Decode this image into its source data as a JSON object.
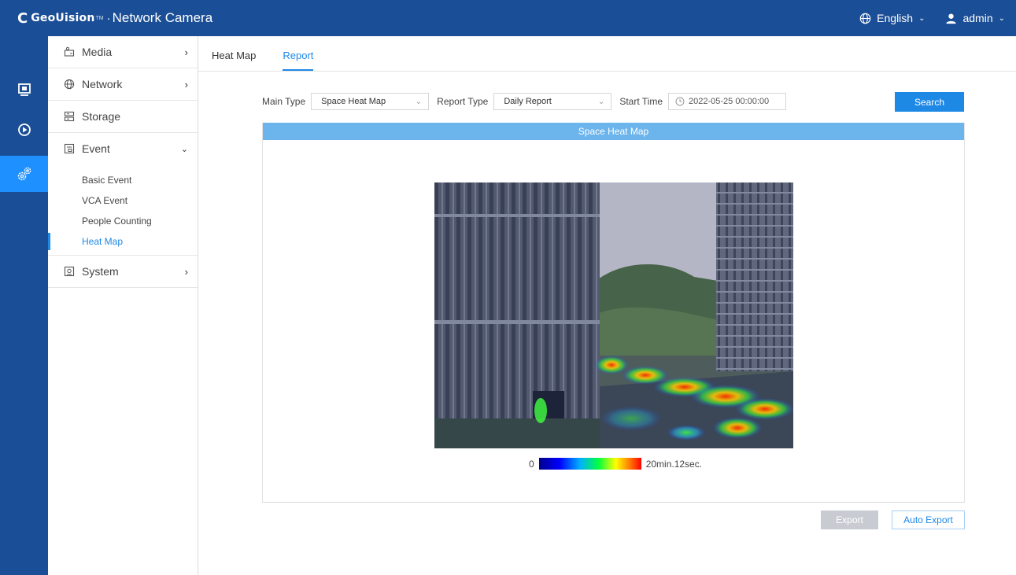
{
  "header": {
    "logo_mark": "C",
    "brand": "GeoUision",
    "brand_tm": "TM",
    "separator": "·",
    "title": "Network Camera",
    "language": "English",
    "user": "admin"
  },
  "rail": {
    "items": [
      {
        "icon": "monitor-icon"
      },
      {
        "icon": "playback-icon"
      },
      {
        "icon": "settings-icon",
        "active": true
      }
    ]
  },
  "sidebar": {
    "items": [
      {
        "label": "Media",
        "icon": "camera-icon"
      },
      {
        "label": "Network",
        "icon": "globe-icon"
      },
      {
        "label": "Storage",
        "icon": "storage-icon"
      },
      {
        "label": "Event",
        "icon": "event-icon",
        "expanded": true,
        "children": [
          {
            "label": "Basic Event"
          },
          {
            "label": "VCA Event"
          },
          {
            "label": "People Counting"
          },
          {
            "label": "Heat Map",
            "active": true
          }
        ]
      },
      {
        "label": "System",
        "icon": "system-icon"
      }
    ]
  },
  "tabs": [
    {
      "label": "Heat Map"
    },
    {
      "label": "Report",
      "active": true
    }
  ],
  "filters": {
    "main_type_label": "Main Type",
    "main_type_value": "Space Heat Map",
    "report_type_label": "Report Type",
    "report_type_value": "Daily Report",
    "start_time_label": "Start Time",
    "start_time_value": "2022-05-25 00:00:00",
    "search_label": "Search"
  },
  "panel": {
    "title": "Space Heat Map"
  },
  "legend": {
    "min": "0",
    "max": "20min.12sec."
  },
  "actions": {
    "export": "Export",
    "auto_export": "Auto Export"
  },
  "colors": {
    "header_bg": "#1a4e96",
    "accent": "#1e88e5",
    "panel_head": "#6cb4ec"
  }
}
